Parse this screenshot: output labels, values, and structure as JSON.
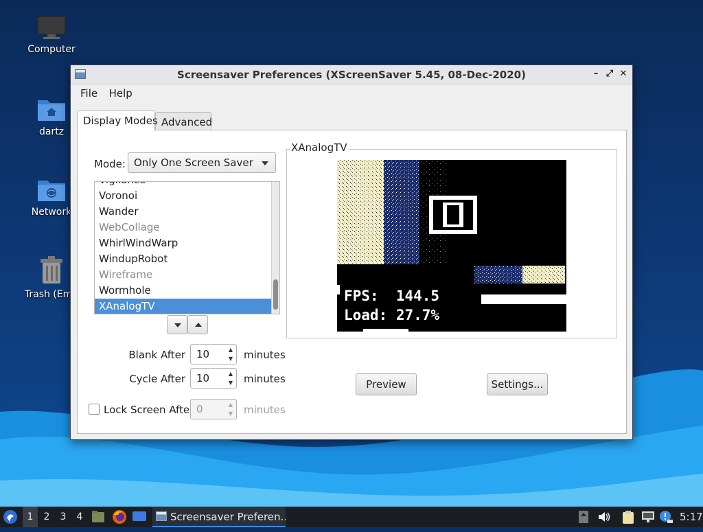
{
  "desktop": {
    "icons": [
      {
        "label": "Computer",
        "icon": "monitor-icon"
      },
      {
        "label": "dartz",
        "icon": "home-folder-icon"
      },
      {
        "label": "Network",
        "icon": "network-folder-icon"
      },
      {
        "label": "Trash (Emp",
        "icon": "trash-icon"
      }
    ]
  },
  "window": {
    "title": "Screensaver Preferences  (XScreenSaver 5.45, 08-Dec-2020)",
    "controls": {
      "minimize": "–",
      "maximize": "⤢",
      "close": "✕"
    },
    "menu": [
      "File",
      "Help"
    ],
    "tabs": [
      "Display Modes",
      "Advanced"
    ],
    "active_tab": "Display Modes",
    "mode": {
      "label": "Mode:",
      "value": "Only One Screen Saver"
    },
    "list": {
      "partial_top": "Vigilance",
      "items": [
        "Voronoi",
        "Wander",
        "WebCollage",
        "WhirlWindWarp",
        "WindupRobot",
        "Wireframe",
        "Wormhole",
        "XAnalogTV"
      ],
      "dimmed": [
        "WebCollage",
        "Wireframe"
      ],
      "selected": "XAnalogTV"
    },
    "blank_after": {
      "label": "Blank After",
      "value": "10",
      "unit": "minutes"
    },
    "cycle_after": {
      "label": "Cycle After",
      "value": "10",
      "unit": "minutes"
    },
    "lock_screen": {
      "label": "Lock Screen After",
      "value": "0",
      "unit": "minutes",
      "checked": false
    },
    "preview": {
      "frame_title": "XAnalogTV",
      "fps_line": "FPS:  144.5",
      "load_line": "Load: 27.7%"
    },
    "buttons": {
      "preview": "Preview",
      "settings": "Settings..."
    }
  },
  "taskbar": {
    "workspaces": [
      "1",
      "2",
      "3",
      "4"
    ],
    "active_workspace": "1",
    "task_label": "Screensaver Preferen...",
    "clock": "5:17"
  },
  "colors": {
    "selection": "#4a90d9",
    "taskbar": "#1a1d22",
    "desktop": "#0d3a78"
  }
}
